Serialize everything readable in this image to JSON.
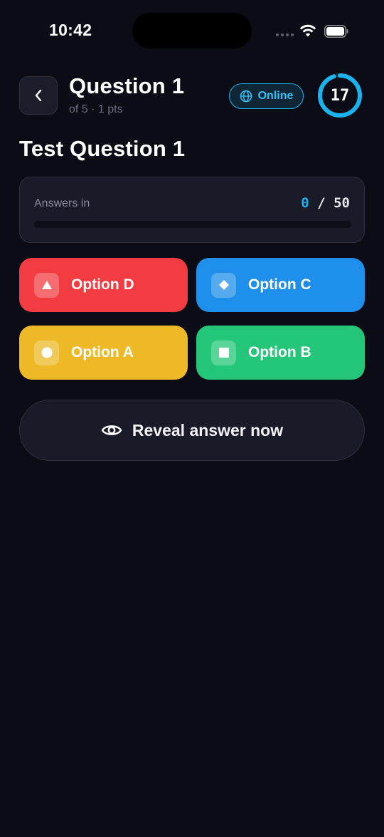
{
  "status_bar": {
    "time": "10:42"
  },
  "header": {
    "title": "Question 1",
    "subtitle": "of 5 · 1 pts",
    "status_badge": "Online",
    "timer_value": "17",
    "timer_fraction": 0.95
  },
  "question": {
    "text": "Test Question 1"
  },
  "answers": {
    "label": "Answers in",
    "current": "0",
    "separator": "/",
    "total": "50",
    "progress_fraction": 0
  },
  "options": [
    {
      "label": "Option D",
      "shape": "triangle-icon",
      "color": "#f23c41"
    },
    {
      "label": "Option C",
      "shape": "diamond-icon",
      "color": "#1e8fea"
    },
    {
      "label": "Option A",
      "shape": "circle-icon",
      "color": "#edb926"
    },
    {
      "label": "Option B",
      "shape": "square-icon",
      "color": "#24c679"
    }
  ],
  "reveal_button": {
    "label": "Reveal answer now",
    "icon": "eye-icon"
  },
  "colors": {
    "background": "#0b0c15",
    "accent": "#1ab3ee"
  }
}
